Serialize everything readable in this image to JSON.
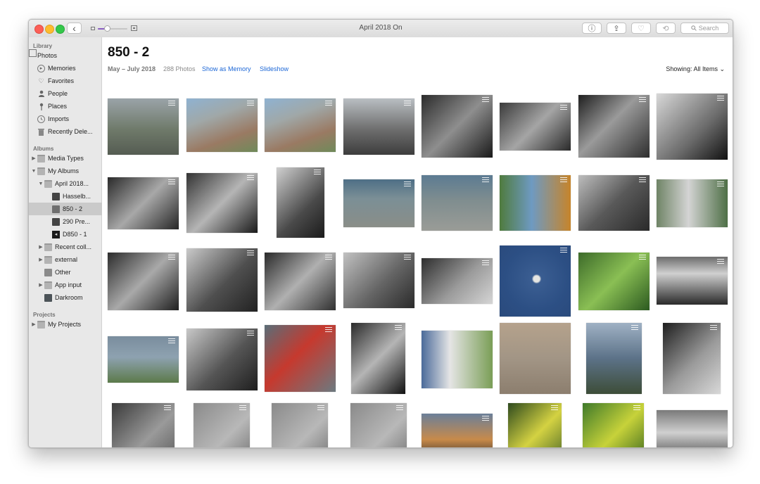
{
  "window": {
    "title": "April 2018 On",
    "back_icon": "‹",
    "info_icon": "ⓘ",
    "share_icon": "⇪",
    "favorite_icon": "♡",
    "rotate_icon": "⟲",
    "search_placeholder": "Search"
  },
  "sidebar": {
    "library_header": "Library",
    "library": [
      {
        "label": "Photos",
        "icon": "photos-icon"
      },
      {
        "label": "Memories",
        "icon": "memories-icon"
      },
      {
        "label": "Favorites",
        "icon": "heart-icon"
      },
      {
        "label": "People",
        "icon": "person-icon"
      },
      {
        "label": "Places",
        "icon": "pin-icon"
      },
      {
        "label": "Imports",
        "icon": "clock-icon"
      },
      {
        "label": "Recently Dele...",
        "icon": "trash-icon"
      }
    ],
    "albums_header": "Albums",
    "albums": [
      {
        "label": "Media Types",
        "icon": "folder-icon"
      },
      {
        "label": "My Albums",
        "icon": "folder-icon"
      },
      {
        "label": "April 2018...",
        "icon": "folder-icon"
      },
      {
        "label": "Hasselb...",
        "icon": "album-thumb-icon"
      },
      {
        "label": "850 - 2",
        "icon": "album-thumb-icon"
      },
      {
        "label": "290 Pre...",
        "icon": "album-thumb-icon"
      },
      {
        "label": "D850 - 1",
        "icon": "album-thumb-icon"
      },
      {
        "label": "Recent coll...",
        "icon": "folder-icon"
      },
      {
        "label": "external",
        "icon": "folder-icon"
      },
      {
        "label": "Other",
        "icon": "album-thumb-icon"
      },
      {
        "label": "App input",
        "icon": "folder-icon"
      },
      {
        "label": "Darkroom",
        "icon": "album-thumb-icon"
      }
    ],
    "projects_header": "Projects",
    "projects": [
      {
        "label": "My Projects",
        "icon": "folder-icon"
      }
    ]
  },
  "main": {
    "title": "850 - 2",
    "date_range": "May – July 2018",
    "photo_count": "288 Photos",
    "show_as_memory": "Show as Memory",
    "slideshow": "Slideshow",
    "showing": "Showing: All Items ⌄"
  },
  "colors": {
    "accent": "#1b66d6",
    "slider": "#8a5ec1"
  }
}
